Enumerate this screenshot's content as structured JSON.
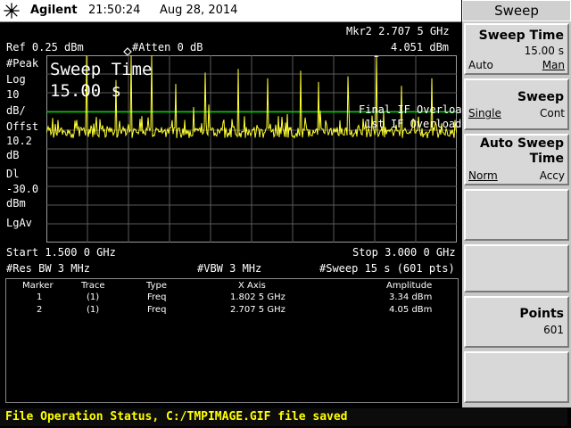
{
  "header": {
    "brand": "Agilent",
    "time": "21:50:24",
    "date": "Aug 28, 2014"
  },
  "display": {
    "ref_level": "Ref 0.25 dBm",
    "atten": "#Atten 0 dB",
    "marker_readout_freq": "Mkr2  2.707 5 GHz",
    "marker_readout_amp": "4.051 dBm",
    "left_labels": [
      "#Peak",
      "Log",
      "10",
      "dB/",
      "Offst",
      "10.2",
      "dB",
      "Dl",
      "-30.0",
      "dBm",
      "LgAv"
    ],
    "active_function_name": "Sweep Time",
    "active_function_value": "15.00  s",
    "overload_1": "Final IF Overload",
    "overload_2": "1st IF Overload",
    "marker_2_label": "2",
    "start_freq": "Start 1.500 0 GHz",
    "stop_freq": "Stop 3.000 0 GHz",
    "res_bw": "#Res BW 3 MHz",
    "vbw": "#VBW 3 MHz",
    "sweep": "#Sweep 15 s (601 pts)",
    "display_line_level": -30.0,
    "ref_level_dbm": 0.25,
    "scale_db_per_div": 10,
    "trace_color": "#ffff33",
    "display_line_color": "#00cc00"
  },
  "marker_table": {
    "headers": [
      "Marker",
      "Trace",
      "Type",
      "X Axis",
      "Amplitude"
    ],
    "rows": [
      [
        "1",
        "(1)",
        "Freq",
        "1.802 5 GHz",
        "3.34 dBm"
      ],
      [
        "2",
        "(1)",
        "Freq",
        "2.707 5 GHz",
        "4.05 dBm"
      ]
    ]
  },
  "status": {
    "text": "File Operation Status, C:/TMPIMAGE.GIF file saved"
  },
  "softkeys": {
    "title": "Sweep",
    "sweep_time": {
      "label": "Sweep Time",
      "value": "15.00  s",
      "opt_left": "Auto",
      "opt_right": "Man"
    },
    "sweep": {
      "label": "Sweep",
      "opt_left": "Single",
      "opt_right": "Cont"
    },
    "auto_sweep_time": {
      "label_1": "Auto Sweep",
      "label_2": "Time",
      "opt_left": "Norm",
      "opt_right": "Accy"
    },
    "points": {
      "label": "Points",
      "value": "601"
    }
  }
}
